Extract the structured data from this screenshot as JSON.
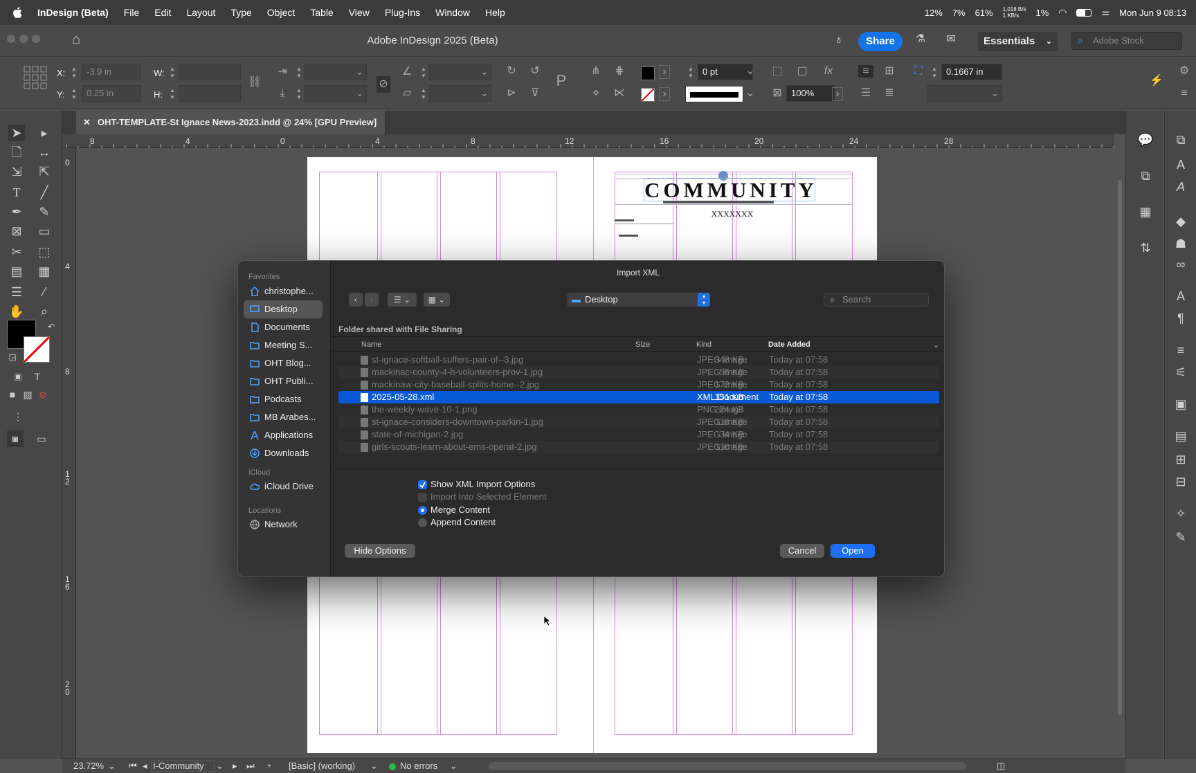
{
  "menubar": {
    "app_name": "InDesign (Beta)",
    "items": [
      "File",
      "Edit",
      "Layout",
      "Type",
      "Object",
      "Table",
      "View",
      "Plug-Ins",
      "Window",
      "Help"
    ],
    "status": {
      "cpu": "12%",
      "gpu": "7%",
      "battery_pct": "61%",
      "net_up": "1,018 B/s",
      "net_down": "1 KB/s",
      "disk": "1%",
      "datetime": "Mon Jun 9  08:13"
    }
  },
  "window": {
    "title": "Adobe InDesign 2025 (Beta)",
    "share_label": "Share",
    "workspace": "Essentials",
    "stock_placeholder": "Adobe Stock"
  },
  "control_panel": {
    "x_label": "X:",
    "x_value": "-3.9 in",
    "y_label": "Y:",
    "y_value": "0.25 in",
    "w_label": "W:",
    "h_label": "H:",
    "stroke_weight": "0 pt",
    "opacity": "100%",
    "gutter": "0.1667 in"
  },
  "document_tab": {
    "label": "OHT-TEMPLATE-St Ignace News-2023.indd @ 24% [GPU Preview]"
  },
  "ruler": {
    "h_ticks": [
      "8",
      "4",
      "0",
      "4",
      "8",
      "12",
      "16",
      "20",
      "24",
      "28"
    ],
    "v_ticks": [
      "0",
      "4",
      "8",
      "1\n2",
      "1\n6",
      "2\n0"
    ]
  },
  "page_content": {
    "headline": "COMMUNITY",
    "subline": "XXXXXXX"
  },
  "statusbar": {
    "zoom": "23.72%",
    "page": "I-Community",
    "profile": "[Basic] (working)",
    "errors": "No errors"
  },
  "dialog": {
    "title": "Import XML",
    "location": "Desktop",
    "search_placeholder": "Search",
    "folder_note": "Folder shared with File Sharing",
    "sidebar": {
      "favorites_label": "Favorites",
      "favorites": [
        "christophe...",
        "Desktop",
        "Documents",
        "Meeting S...",
        "OHT Blog...",
        "OHT Publi...",
        "Podcasts",
        "MB Arabes...",
        "Applications",
        "Downloads"
      ],
      "icloud_label": "iCloud",
      "icloud": [
        "iCloud Drive"
      ],
      "locations_label": "Locations",
      "locations": [
        "Network"
      ]
    },
    "columns": {
      "name": "Name",
      "size": "Size",
      "kind": "Kind",
      "date": "Date Added"
    },
    "files": [
      {
        "name": "st-ignace-softball-suffers-pair-of--3.jpg",
        "size": "348 KB",
        "kind": "JPEG image",
        "date": "Today at 07:58"
      },
      {
        "name": "mackinac-county-4-h-volunteers-prov-1.jpg",
        "size": "56 KB",
        "kind": "JPEG image",
        "date": "Today at 07:58"
      },
      {
        "name": "mackinaw-city-baseball-splits-home--2.jpg",
        "size": "172 KB",
        "kind": "JPEG image",
        "date": "Today at 07:58"
      },
      {
        "name": "2025-05-28.xml",
        "size": "151 KB",
        "kind": "XML Document",
        "date": "Today at 07:58"
      },
      {
        "name": "the-weekly-wave-10-1.png",
        "size": "224 KB",
        "kind": "PNG image",
        "date": "Today at 07:58"
      },
      {
        "name": "st-ignace-considers-downtown-parkin-1.jpg",
        "size": "119 KB",
        "kind": "JPEG image",
        "date": "Today at 07:58"
      },
      {
        "name": "state-of-michigan-2.jpg",
        "size": "34 KB",
        "kind": "JPEG image",
        "date": "Today at 07:58"
      },
      {
        "name": "girls-scouts-learn-about-ems-operat-2.jpg",
        "size": "110 KB",
        "kind": "JPEG image",
        "date": "Today at 07:58"
      }
    ],
    "selected_file_index": 3,
    "options": {
      "show_xml_import_options": "Show XML Import Options",
      "import_into_selected": "Import Into Selected Element",
      "merge_content": "Merge Content",
      "append_content": "Append Content"
    },
    "buttons": {
      "hide_options": "Hide Options",
      "cancel": "Cancel",
      "open": "Open"
    }
  },
  "colors": {
    "accent": "#1e6ff0",
    "selection": "#0a5ad8",
    "guide": "#d38ae0"
  }
}
